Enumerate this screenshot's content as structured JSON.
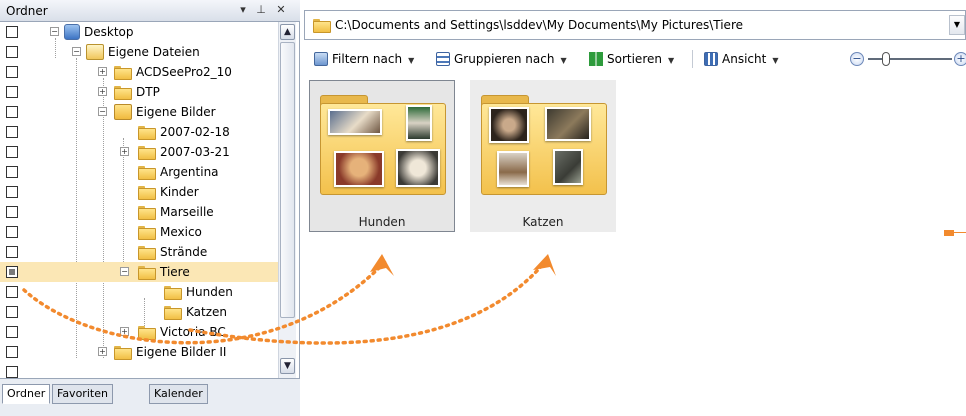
{
  "panel": {
    "title": "Ordner",
    "tabs": [
      "Ordner",
      "Favoriten",
      "Kalender"
    ]
  },
  "tree": [
    {
      "label": "Desktop",
      "expander": "−",
      "icon": "desktop-icon",
      "checked": false
    },
    {
      "label": "Eigene Dateien",
      "expander": "−",
      "icon": "documents-icon",
      "checked": false
    },
    {
      "label": "ACDSeePro2_10",
      "expander": "+",
      "icon": "folder-icon",
      "checked": false
    },
    {
      "label": "DTP",
      "expander": "+",
      "icon": "folder-icon",
      "checked": false
    },
    {
      "label": "Eigene Bilder",
      "expander": "−",
      "icon": "pictures-folder-icon",
      "checked": false
    },
    {
      "label": "2007-02-18",
      "expander": "",
      "icon": "folder-icon",
      "checked": false
    },
    {
      "label": "2007-03-21",
      "expander": "+",
      "icon": "folder-icon",
      "checked": false
    },
    {
      "label": "Argentina",
      "expander": "",
      "icon": "folder-icon",
      "checked": false
    },
    {
      "label": "Kinder",
      "expander": "",
      "icon": "folder-icon",
      "checked": false
    },
    {
      "label": "Marseille",
      "expander": "",
      "icon": "folder-icon",
      "checked": false
    },
    {
      "label": "Mexico",
      "expander": "",
      "icon": "folder-icon",
      "checked": false
    },
    {
      "label": "Strände",
      "expander": "",
      "icon": "folder-icon",
      "checked": false
    },
    {
      "label": "Tiere",
      "expander": "−",
      "icon": "folder-icon",
      "checked": true,
      "selected": true
    },
    {
      "label": "Hunden",
      "expander": "",
      "icon": "folder-icon",
      "checked": false
    },
    {
      "label": "Katzen",
      "expander": "",
      "icon": "folder-icon",
      "checked": false
    },
    {
      "label": "Victoria BC",
      "expander": "+",
      "icon": "folder-icon",
      "checked": false
    },
    {
      "label": "Eigene Bilder II",
      "expander": "+",
      "icon": "folder-icon",
      "checked": false
    }
  ],
  "address": {
    "path": "C:\\Documents and Settings\\lsddev\\My Documents\\My Pictures\\Tiere"
  },
  "toolbar": {
    "filter_label": "Filtern nach",
    "group_label": "Gruppieren nach",
    "sort_label": "Sortieren",
    "view_label": "Ansicht"
  },
  "thumbnails": [
    {
      "label": "Hunden",
      "selected": true
    },
    {
      "label": "Katzen",
      "selected": false
    }
  ],
  "colors": {
    "selection": "#fbe7b5",
    "arrow": "#f28a2e",
    "folder": "#f3c14c"
  }
}
